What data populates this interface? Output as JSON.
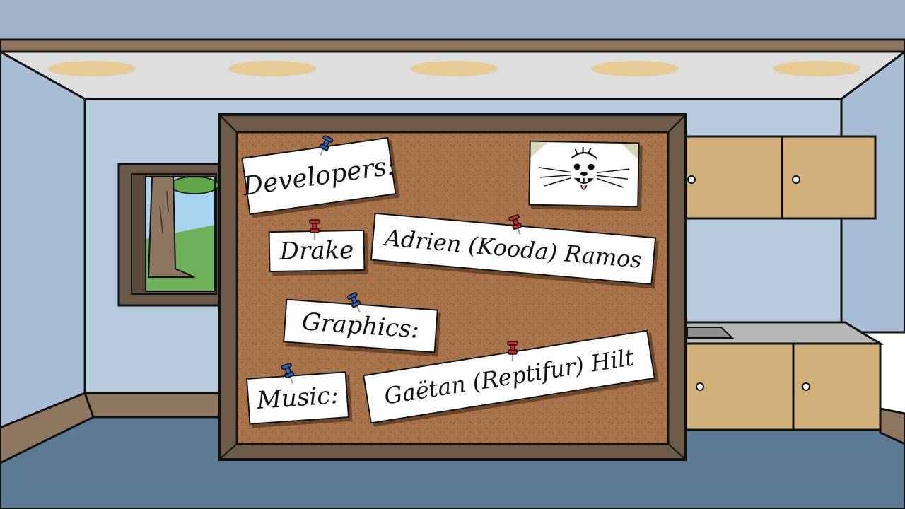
{
  "credits": {
    "developers_heading": "Developers:",
    "developer_1": "Drake",
    "developer_2": "Adrien (Kooda) Ramos",
    "graphics_heading": "Graphics:",
    "music_heading": "Music:",
    "graphics_music_artist": "Gaëtan (Reptifur) Hilt"
  },
  "colors": {
    "wall": "#b7c9dd",
    "floor": "#5c7a93",
    "cork": "#a8734a",
    "frame": "#6e5a48",
    "cabinet": "#d2b07a",
    "pin_blue": "#2d5db8",
    "pin_red": "#cc2a2a"
  },
  "icons": {
    "mascot": "beaver-face-icon",
    "pin_blue": "blue-pushpin-icon",
    "pin_red": "red-pushpin-icon"
  }
}
